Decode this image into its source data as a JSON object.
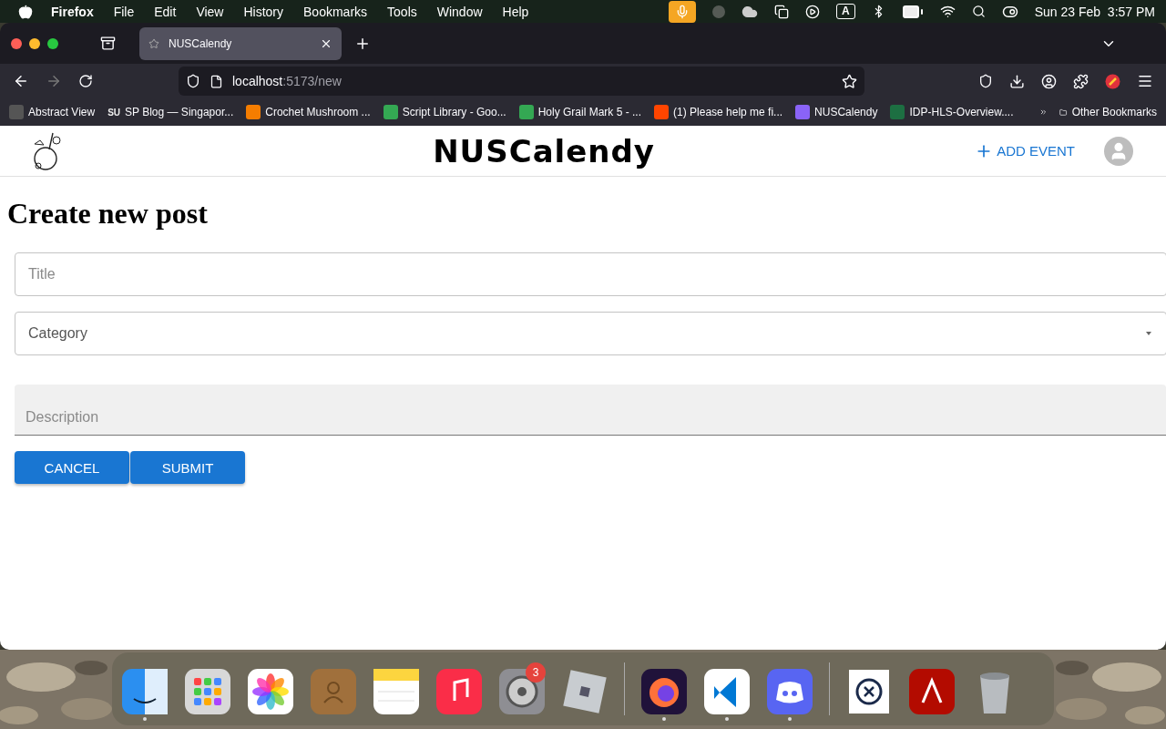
{
  "menu_bar": {
    "app": "Firefox",
    "items": [
      "File",
      "Edit",
      "View",
      "History",
      "Bookmarks",
      "Tools",
      "Window",
      "Help"
    ],
    "input_source": "A",
    "date": "Sun 23 Feb",
    "time": "3:57 PM"
  },
  "browser": {
    "tabs": [
      {
        "title": "NUSCalendy",
        "selected": true
      }
    ],
    "address": {
      "host": "localhost",
      "path": ":5173/new"
    },
    "bookmarks": [
      {
        "kind": "abstract",
        "label": "Abstract View"
      },
      {
        "kind": "letters",
        "icon_text": "SU",
        "label": "SP Blog — Singapor..."
      },
      {
        "kind": "blogger",
        "label": "Crochet Mushroom ..."
      },
      {
        "kind": "drive",
        "label": "Script Library - Goo..."
      },
      {
        "kind": "drive",
        "label": "Holy Grail Mark 5 - ..."
      },
      {
        "kind": "reddit",
        "label": "(1) Please help me fi..."
      },
      {
        "kind": "vite",
        "label": "NUSCalendy"
      },
      {
        "kind": "excel",
        "label": "IDP-HLS-Overview...."
      }
    ],
    "other_bookmarks": "Other Bookmarks"
  },
  "app": {
    "title": "NUSCalendy",
    "add_event": "ADD EVENT",
    "heading": "Create new post",
    "fields": [
      {
        "kind": "outlined",
        "placeholder": "Title"
      },
      {
        "kind": "select",
        "placeholder": "Category"
      },
      {
        "kind": "filled",
        "placeholder": "Description"
      }
    ],
    "buttons": [
      "CANCEL",
      "SUBMIT"
    ]
  },
  "dock": [
    {
      "kind": "finder",
      "running": true
    },
    {
      "kind": "launchpad",
      "running": false
    },
    {
      "kind": "photos",
      "running": false
    },
    {
      "kind": "contacts",
      "running": false
    },
    {
      "kind": "notes",
      "running": false
    },
    {
      "kind": "music",
      "running": false
    },
    {
      "kind": "settings",
      "running": false,
      "badge": "3"
    },
    {
      "kind": "roblox",
      "running": false
    },
    {
      "kind": "divider"
    },
    {
      "kind": "firefox",
      "running": true
    },
    {
      "kind": "vscode",
      "running": true
    },
    {
      "kind": "discord",
      "running": true
    },
    {
      "kind": "divider"
    },
    {
      "kind": "document",
      "running": false
    },
    {
      "kind": "acrobat",
      "running": false
    },
    {
      "kind": "trash",
      "running": false
    }
  ]
}
